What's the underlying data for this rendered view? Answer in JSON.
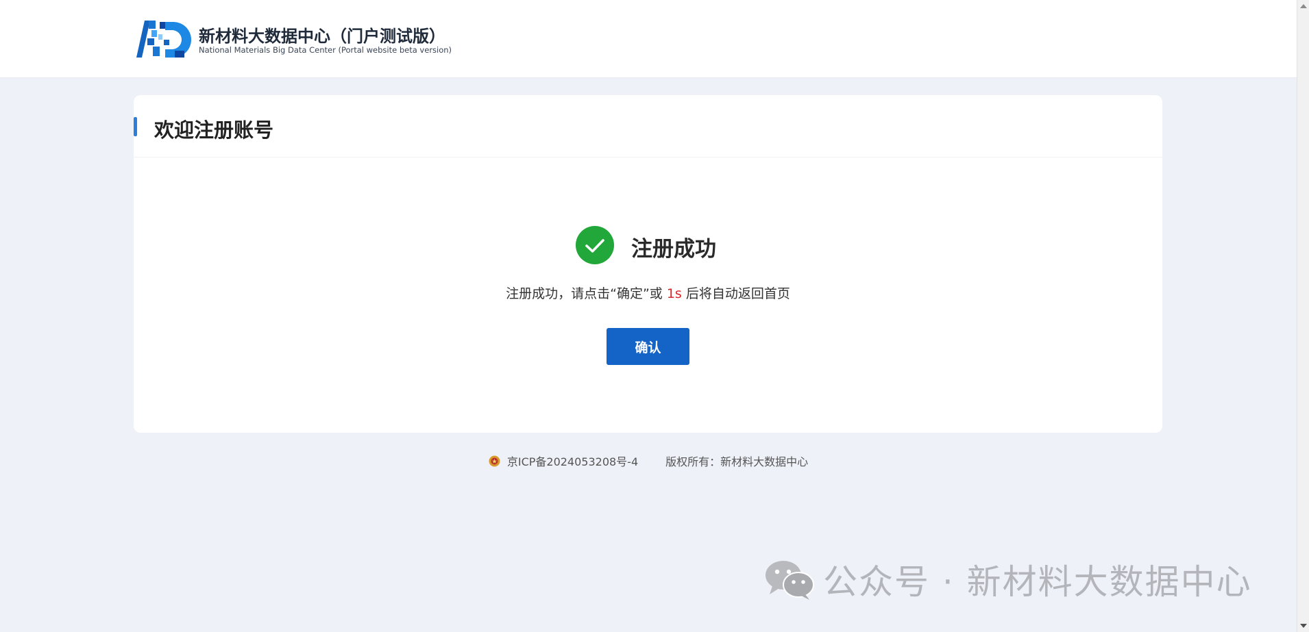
{
  "header": {
    "logo_icon": "nmbdc-logo-icon",
    "title": "新材料大数据中心（门户测试版）",
    "subtitle": "National Materials Big Data Center (Portal website beta version)"
  },
  "card": {
    "title": "欢迎注册账号",
    "accent_color": "#2b7fd8",
    "success": {
      "icon": "check-circle-icon",
      "icon_color": "#22a83a",
      "title": "注册成功"
    },
    "message": {
      "before": "注册成功，请点击“确定”或 ",
      "countdown": "1s",
      "after": " 后将自动返回首页"
    },
    "confirm_label": "确认",
    "confirm_color": "#1463c6"
  },
  "footer": {
    "icp_icon": "police-badge-icon",
    "icp": "京ICP备2024053208号-4",
    "copyright": "版权所有：新材料大数据中心"
  },
  "watermark": {
    "icon": "wechat-icon",
    "text": "公众号 · 新材料大数据中心"
  }
}
